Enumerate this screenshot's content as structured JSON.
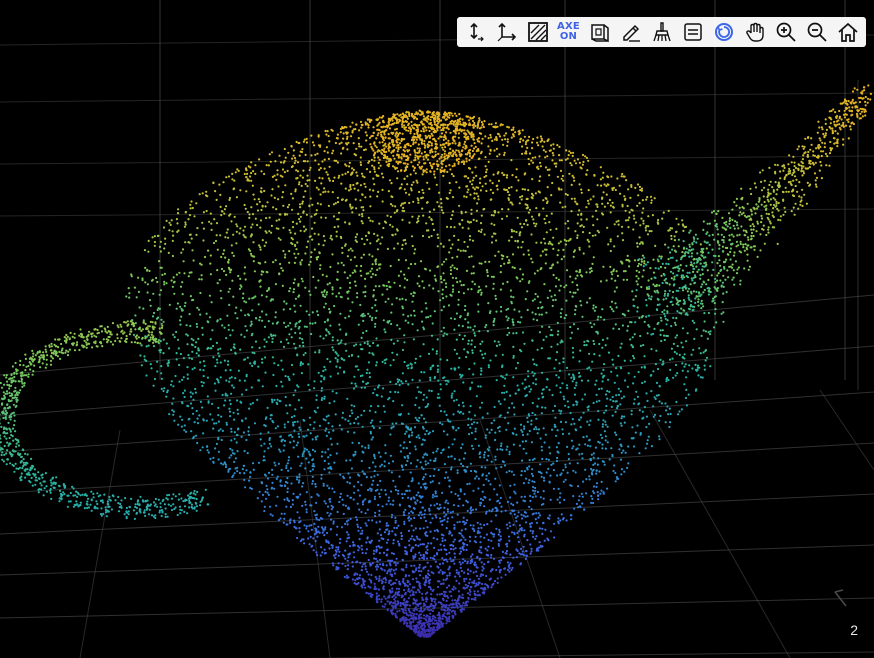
{
  "viewer": {
    "background_color": "#000000",
    "grid_color": "#4a4a4a",
    "colormap": [
      "#3b2aa8",
      "#3f63e6",
      "#2b93c7",
      "#27b5a0",
      "#7bc95a",
      "#c8bf36",
      "#e8b21f"
    ],
    "point_count_estimate": 9000
  },
  "toolbar": {
    "axes_toggle_text_top": "AXE",
    "axes_toggle_text_bottom": "ON",
    "tools": [
      {
        "name": "pan-vertical-tool",
        "icon": "vertical-arrows-icon"
      },
      {
        "name": "axes-tool",
        "icon": "axes-icon"
      },
      {
        "name": "background-toggle",
        "icon": "hatched-square-icon"
      },
      {
        "name": "axes-visibility-toggle",
        "icon": "axe-on-icon"
      },
      {
        "name": "view-cube-tool",
        "icon": "cube-icon"
      },
      {
        "name": "color-tool",
        "icon": "pen-fill-icon"
      },
      {
        "name": "data-cleaning-tool",
        "icon": "brush-icon"
      },
      {
        "name": "legend-tool",
        "icon": "list-icon"
      },
      {
        "name": "rotate-tool",
        "icon": "rotate-icon"
      },
      {
        "name": "pan-tool",
        "icon": "hand-icon"
      },
      {
        "name": "zoom-in-tool",
        "icon": "zoom-in-icon"
      },
      {
        "name": "zoom-out-tool",
        "icon": "zoom-out-icon"
      },
      {
        "name": "home-tool",
        "icon": "home-icon"
      }
    ],
    "active_tool": "rotate-tool",
    "accent_color": "#3d66e8"
  },
  "axis": {
    "tick_label": "2"
  }
}
